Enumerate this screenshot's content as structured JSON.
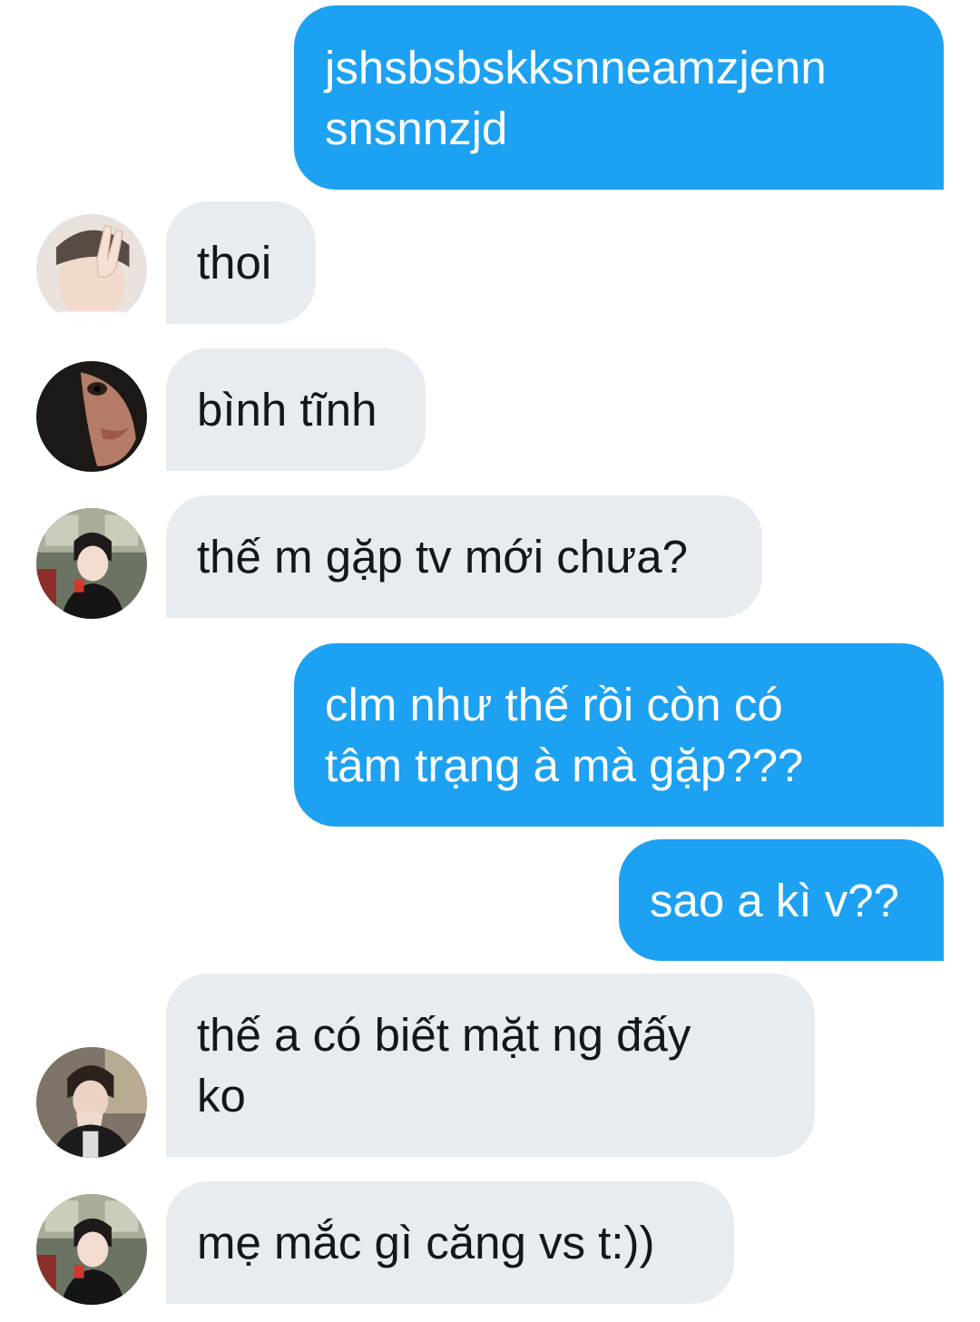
{
  "messages": [
    {
      "direction": "sent",
      "text": "jshsbsbskksnneamzjenn\nsnsnnzjd"
    },
    {
      "direction": "received",
      "avatar": "avatar-peace-sign",
      "text": "thoi"
    },
    {
      "direction": "received",
      "avatar": "avatar-dark-closeup",
      "text": "bình tĩnh"
    },
    {
      "direction": "received",
      "avatar": "avatar-bus-window",
      "text": "thế m gặp tv mới chưa?"
    },
    {
      "direction": "sent",
      "text": "clm như thế rồi còn có\ntâm trạng à mà gặp???"
    },
    {
      "direction": "sent",
      "text": "sao a kì v??"
    },
    {
      "direction": "received",
      "avatar": "avatar-hand-on-chin",
      "text": "thế a có biết mặt ng đấy\nko"
    },
    {
      "direction": "received",
      "avatar": "avatar-bus-window",
      "text": "mẹ mắc gì căng vs t:))"
    }
  ],
  "colors": {
    "sent_bubble": "#1da1f2",
    "received_bubble": "#e6ecf0",
    "received_text": "#14171a",
    "sent_text": "#ffffff"
  }
}
